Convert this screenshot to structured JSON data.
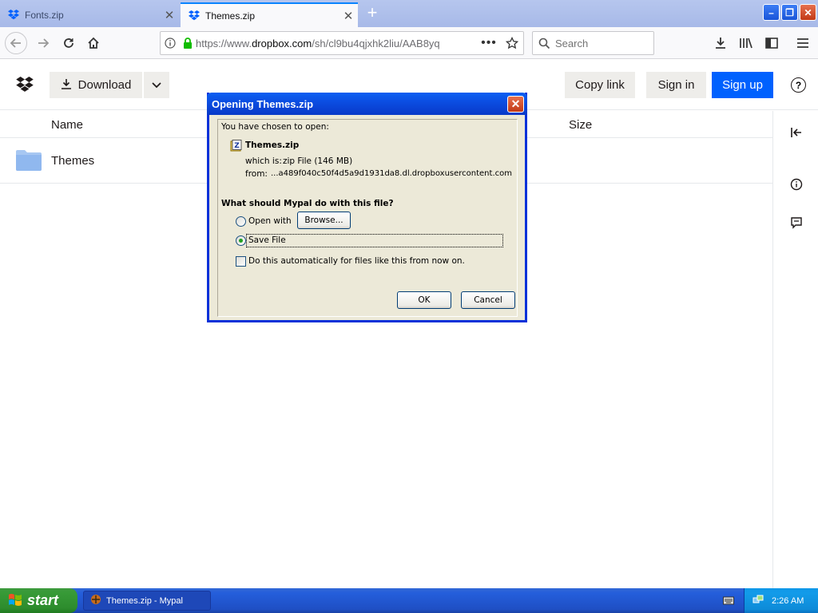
{
  "browser": {
    "tabs": [
      {
        "label": "Fonts.zip",
        "active": false
      },
      {
        "label": "Themes.zip",
        "active": true
      }
    ],
    "url_prefix": "https://www.",
    "url_domain": "dropbox.com",
    "url_path": "/sh/cl9bu4qjxhk2liu/AAB8yq",
    "search_placeholder": "Search"
  },
  "dropbox": {
    "download_label": "Download",
    "copy_link_label": "Copy link",
    "sign_in_label": "Sign in",
    "sign_up_label": "Sign up",
    "help_symbol": "?",
    "columns": {
      "name": "Name",
      "size": "Size"
    },
    "files": [
      {
        "name": "Themes"
      }
    ]
  },
  "dialog": {
    "title": "Opening Themes.zip",
    "intro": "You have chosen to open:",
    "filename": "Themes.zip",
    "which_is_label": "which is:",
    "which_is_value": "zip File (146 MB)",
    "from_label": "from:",
    "from_value": "...a489f040c50f4d5a9d1931da8.dl.dropboxusercontent.com",
    "question": "What should Mypal do with this file?",
    "open_with_label": "Open with",
    "browse_label": "Browse...",
    "save_file_label": "Save File",
    "auto_label": "Do this automatically for files like this from now on.",
    "ok_label": "OK",
    "cancel_label": "Cancel",
    "selected_option": "save_file"
  },
  "taskbar": {
    "start_label": "start",
    "task_label": "Themes.zip - Mypal",
    "clock": "2:26 AM"
  },
  "colors": {
    "dropbox_blue": "#0061fe",
    "xp_title_blue": "#0a5ff2",
    "xp_start_green": "#379a37"
  }
}
